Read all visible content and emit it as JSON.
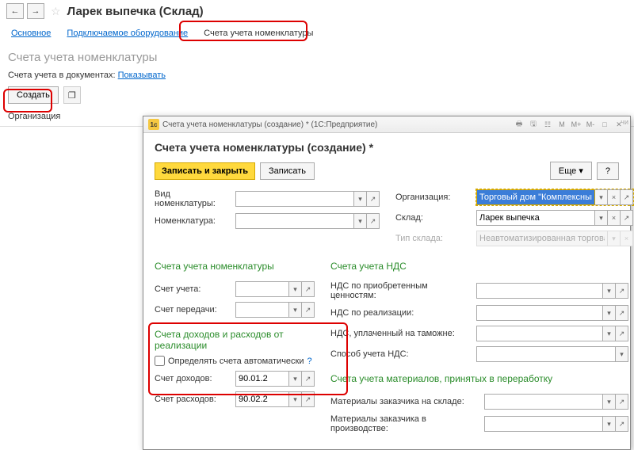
{
  "nav": {
    "back": "←",
    "fwd": "→"
  },
  "page_title": "Ларек выпечка (Склад)",
  "tabs": [
    "Основное",
    "Подключаемое оборудование",
    "Счета учета номенклатуры"
  ],
  "subtitle": "Счета учета номенклатуры",
  "docs_label": "Счета учета в документах:",
  "docs_link": "Показывать",
  "toolbar": {
    "create": "Создать"
  },
  "table": {
    "col1": "Организация"
  },
  "chi": "чи",
  "modal": {
    "win_title": "Счета учета номенклатуры (создание) * (1С:Предприятие)",
    "heading": "Счета учета номенклатуры (создание) *",
    "btn_save_close": "Записать и закрыть",
    "btn_save": "Записать",
    "btn_more": "Еще",
    "btn_help": "?",
    "left": {
      "type_label": "Вид номенклатуры:",
      "type_value": "",
      "nom_label": "Номенклатура:",
      "nom_value": ""
    },
    "right": {
      "org_label": "Организация:",
      "org_value": "Торговый дом \"Комплексный\" ООО",
      "wh_label": "Склад:",
      "wh_value": "Ларек выпечка",
      "wht_label": "Тип склада:",
      "wht_value": "Неавтоматизированная торговая точка"
    },
    "sec1": {
      "title": "Счета учета номенклатуры",
      "acct_label": "Счет учета:",
      "acct_value": "",
      "trans_label": "Счет передачи:",
      "trans_value": ""
    },
    "sec_vat": {
      "title": "Счета учета НДС",
      "r1": "НДС по приобретенным ценностям:",
      "r2": "НДС по реализации:",
      "r3": "НДС, уплаченный на таможне:",
      "r4": "Способ учета НДС:"
    },
    "sec_pr": {
      "title": "Счета доходов и расходов от реализации",
      "auto_label": "Определять счета автоматически",
      "income_label": "Счет доходов:",
      "income_value": "90.01.2",
      "expense_label": "Счет расходов:",
      "expense_value": "90.02.2"
    },
    "sec_mat": {
      "title": "Счета учета материалов, принятых в переработку",
      "r1": "Материалы заказчика на складе:",
      "r2": "Материалы заказчика в производстве:"
    }
  }
}
